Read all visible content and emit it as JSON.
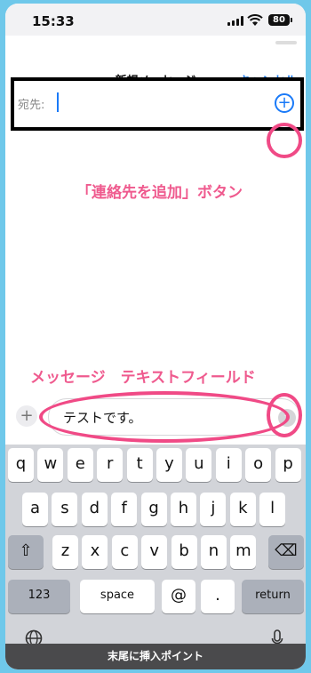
{
  "status_bar": {
    "time": "15:33",
    "battery": "80"
  },
  "compose": {
    "title": "新規メッセージ",
    "cancel_label": "キャンセル",
    "to_label": "宛先:"
  },
  "annotations": {
    "add_contact": "「連絡先を追加」ボタン",
    "message_field": "メッセージ　テキストフィールド"
  },
  "message": {
    "value": "テストです。"
  },
  "keyboard": {
    "row1": [
      "q",
      "w",
      "e",
      "r",
      "t",
      "y",
      "u",
      "i",
      "o",
      "p"
    ],
    "row2": [
      "a",
      "s",
      "d",
      "f",
      "g",
      "h",
      "j",
      "k",
      "l"
    ],
    "row3": [
      "z",
      "x",
      "c",
      "v",
      "b",
      "n",
      "m"
    ],
    "numbers_label": "123",
    "space_label": "space",
    "at_label": "@",
    "period_label": ".",
    "return_label": "return"
  },
  "toast": {
    "text": "末尾に挿入ポイント"
  },
  "colors": {
    "accent": "#1a7af8",
    "annotation": "#ef5a8e",
    "background": "#6fc8ea"
  }
}
